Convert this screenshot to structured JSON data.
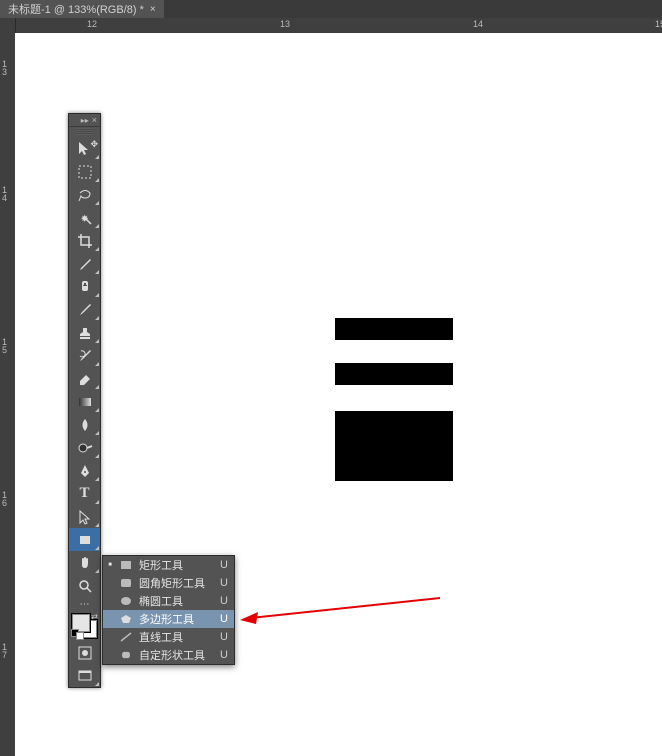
{
  "tab": {
    "title": "未标题-1 @ 133%(RGB/8) *"
  },
  "ruler_h": [
    "12",
    "13",
    "14",
    "15"
  ],
  "ruler_v": [
    "13",
    "14",
    "15",
    "16",
    "17"
  ],
  "flyout": {
    "items": [
      {
        "label": "矩形工具",
        "key": "U",
        "active": true
      },
      {
        "label": "圆角矩形工具",
        "key": "U"
      },
      {
        "label": "椭圆工具",
        "key": "U"
      },
      {
        "label": "多边形工具",
        "key": "U",
        "highlight": true
      },
      {
        "label": "直线工具",
        "key": "U"
      },
      {
        "label": "自定形状工具",
        "key": "U"
      }
    ]
  }
}
